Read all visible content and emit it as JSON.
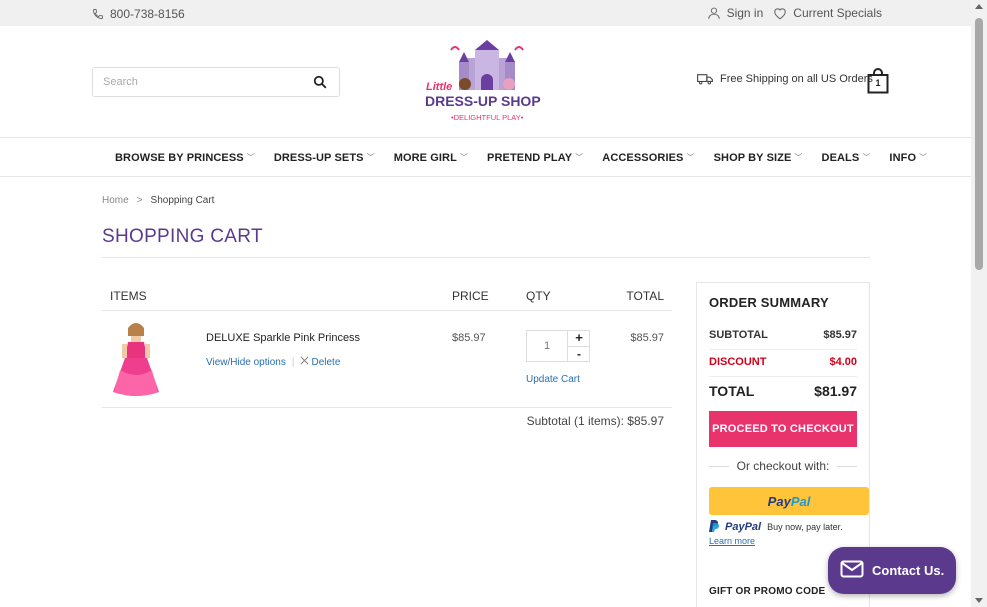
{
  "topbar": {
    "phone": "800-738-8156",
    "sign_in": "Sign in",
    "specials": "Current Specials"
  },
  "header": {
    "search_placeholder": "Search",
    "logo": {
      "line1": "Little",
      "line2": "DRESS-UP SHOP",
      "tagline": "•DELIGHTFUL PLAY•"
    },
    "shipping": "Free Shipping on all US Orders",
    "cart_count": "1"
  },
  "nav": [
    {
      "label": "BROWSE BY PRINCESS"
    },
    {
      "label": "DRESS-UP SETS"
    },
    {
      "label": "MORE GIRL"
    },
    {
      "label": "PRETEND PLAY"
    },
    {
      "label": "ACCESSORIES"
    },
    {
      "label": "SHOP BY SIZE"
    },
    {
      "label": "DEALS"
    },
    {
      "label": "INFO"
    }
  ],
  "breadcrumb": {
    "home": "Home",
    "separator": ">",
    "current": "Shopping Cart"
  },
  "page_title": "SHOPPING CART",
  "cart": {
    "headers": {
      "items": "ITEMS",
      "price": "PRICE",
      "qty": "QTY",
      "total": "TOTAL"
    },
    "items": [
      {
        "name": "DELUXE Sparkle Pink Princess",
        "view_options": "View/Hide options",
        "delete": "Delete",
        "price": "$85.97",
        "qty": "1",
        "plus": "+",
        "minus": "-",
        "update": "Update Cart",
        "total": "$85.97"
      }
    ],
    "subtotal_line": "Subtotal (1 items): $85.97"
  },
  "summary": {
    "title": "ORDER SUMMARY",
    "subtotal_label": "SUBTOTAL",
    "subtotal_value": "$85.97",
    "discount_label": "DISCOUNT",
    "discount_value": "$4.00",
    "total_label": "TOTAL",
    "total_value": "$81.97",
    "checkout": "PROCEED TO CHECKOUT",
    "or_checkout": "Or checkout with:",
    "paypal_pay": "Pay",
    "paypal_pal": "Pal",
    "paylater_brand": "PayPal",
    "paylater_text": "Buy now, pay later.",
    "learn_more": "Learn more",
    "promo": "GIFT OR PROMO CODE"
  },
  "contact": "Contact Us.",
  "colors": {
    "brand_purple": "#5b3a8e",
    "checkout_pink": "#e8336d",
    "discount_red": "#d0021b",
    "paypal_yellow": "#ffc439",
    "link_blue": "#2a6fb0"
  }
}
